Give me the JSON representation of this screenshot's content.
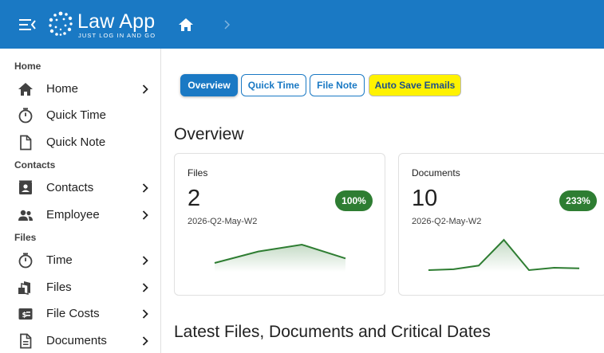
{
  "app": {
    "name": "Law App",
    "tagline": "JUST LOG IN AND GO",
    "colors": {
      "primary": "#1a79c4",
      "success": "#2e7d32",
      "highlight": "#fff200"
    }
  },
  "header": {
    "menu_icon": "menu-collapse-icon",
    "home_icon": "home-icon",
    "breadcrumb_separator_icon": "chevron-right-icon"
  },
  "sidebar": {
    "sections": [
      {
        "label": "Home"
      },
      {
        "label": "Contacts"
      },
      {
        "label": "Files"
      }
    ],
    "items": [
      {
        "label": "Home",
        "icon": "home-icon",
        "has_children": true
      },
      {
        "label": "Quick Time",
        "icon": "stopwatch-icon",
        "has_children": false
      },
      {
        "label": "Quick Note",
        "icon": "document-icon",
        "has_children": false
      },
      {
        "label": "Contacts",
        "icon": "contact-card-icon",
        "has_children": true
      },
      {
        "label": "Employee",
        "icon": "people-icon",
        "has_children": true
      },
      {
        "label": "Time",
        "icon": "stopwatch-icon",
        "has_children": true
      },
      {
        "label": "Files",
        "icon": "files-stack-icon",
        "has_children": true
      },
      {
        "label": "File Costs",
        "icon": "money-icon",
        "has_children": true
      },
      {
        "label": "Documents",
        "icon": "document-lines-icon",
        "has_children": true
      }
    ]
  },
  "tabs": [
    {
      "label": "Overview",
      "active": true
    },
    {
      "label": "Quick Time",
      "active": false
    },
    {
      "label": "File Note",
      "active": false
    },
    {
      "label": "Auto Save Emails",
      "active": false,
      "highlighted": true
    }
  ],
  "main": {
    "overview_heading": "Overview",
    "latest_heading": "Latest Files, Documents and Critical Dates"
  },
  "cards": [
    {
      "title": "Files",
      "value": "2",
      "badge": "100%",
      "period": "2026-Q2-May-W2",
      "sparkline": [
        1,
        3.5,
        5,
        2
      ]
    },
    {
      "title": "Documents",
      "value": "10",
      "badge": "233%",
      "period": "2026-Q2-May-W2",
      "sparkline": [
        0,
        0.3,
        1.5,
        10,
        0,
        0.8,
        0.6
      ]
    }
  ]
}
